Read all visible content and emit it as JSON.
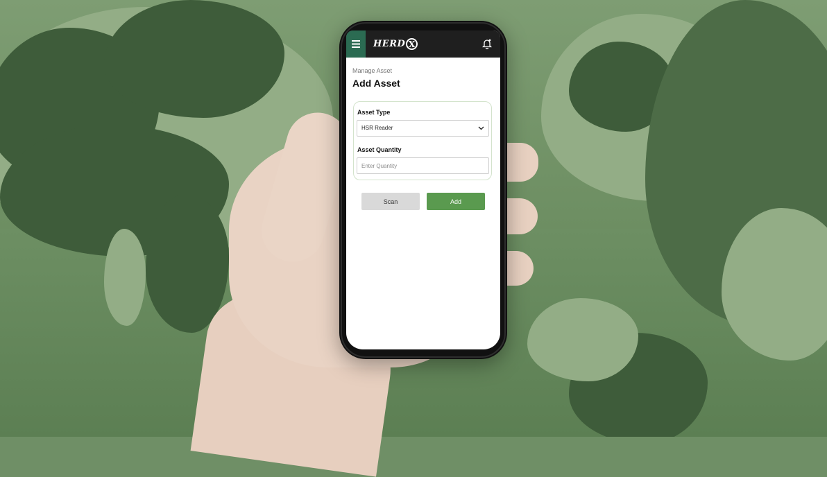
{
  "header": {
    "logo_text": "HERD",
    "logo_mark": "X",
    "menu_icon": "hamburger-menu-icon",
    "notification_icon": "bell-icon"
  },
  "page": {
    "breadcrumb": "Manage Asset",
    "title": "Add Asset"
  },
  "form": {
    "asset_type_label": "Asset Type",
    "asset_type_value": "HSR Reader",
    "asset_quantity_label": "Asset Quantity",
    "asset_quantity_placeholder": "Enter Quantity",
    "asset_quantity_value": ""
  },
  "actions": {
    "scan_label": "Scan",
    "add_label": "Add"
  },
  "colors": {
    "brand_green": "#2b6b52",
    "add_button": "#5a9a4f",
    "scan_button": "#d9d9d9",
    "topbar": "#1f1f1f"
  }
}
